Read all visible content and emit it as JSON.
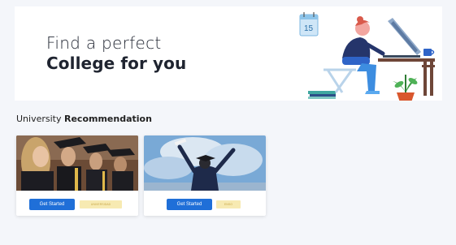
{
  "hero": {
    "title_line1": "Find a perfect",
    "title_line2": "College for you",
    "calendar_number": "15"
  },
  "section": {
    "title_regular": "University ",
    "title_bold": "Recommendation"
  },
  "cards": [
    {
      "button_label": "Get Started",
      "tag_label": "UNIVERSIDAD"
    },
    {
      "button_label": "Get Started",
      "tag_label": "ENSO"
    }
  ],
  "colors": {
    "accent": "#1f6fd8",
    "tag_bg": "#f7eab2",
    "page_bg": "#f4f6fa"
  }
}
